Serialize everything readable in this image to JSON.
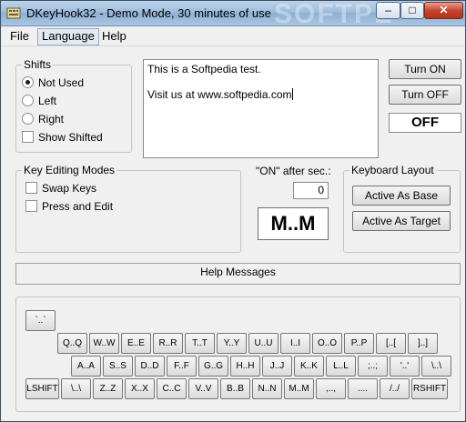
{
  "window": {
    "title": "DKeyHook32 - Demo Mode, 30 minutes of use",
    "watermark": "SOFTPE"
  },
  "menu": [
    "File",
    "Language",
    "Help"
  ],
  "shifts": {
    "label": "Shifts",
    "options": [
      "Not Used",
      "Left",
      "Right"
    ],
    "selected": "Not Used",
    "show_shifted": "Show Shifted"
  },
  "text": {
    "line1": "This is a Softpedia test.",
    "line2": "Visit us at www.softpedia.com"
  },
  "controls": {
    "turn_on": "Turn ON",
    "turn_off": "Turn OFF",
    "status": "OFF"
  },
  "editing": {
    "label": "Key Editing Modes",
    "swap": "Swap Keys",
    "press_edit": "Press and Edit"
  },
  "delay": {
    "label": "\"ON\" after sec.:",
    "value": "0"
  },
  "mode_display": "M..M",
  "layout": {
    "label": "Keyboard Layout",
    "base": "Active As Base",
    "target": "Active As Target"
  },
  "help_messages": "Help Messages",
  "keyboard": {
    "row0": [
      "`..`"
    ],
    "row1": [
      "Q..Q",
      "W..W",
      "E..E",
      "R..R",
      "T..T",
      "Y..Y",
      "U..U",
      "I..I",
      "O..O",
      "P..P",
      "[..[",
      "]..]"
    ],
    "row2": [
      "A..A",
      "S..S",
      "D..D",
      "F..F",
      "G..G",
      "H..H",
      "J..J",
      "K..K",
      "L..L",
      ";..;",
      "'..'",
      "\\..\\"
    ],
    "row3": [
      "LSHIFT",
      "\\..\\",
      "Z..Z",
      "X..X",
      "C..C",
      "V..V",
      "B..B",
      "N..N",
      "M..M",
      ",..,",
      "....",
      "/../",
      "RSHIFT"
    ]
  }
}
